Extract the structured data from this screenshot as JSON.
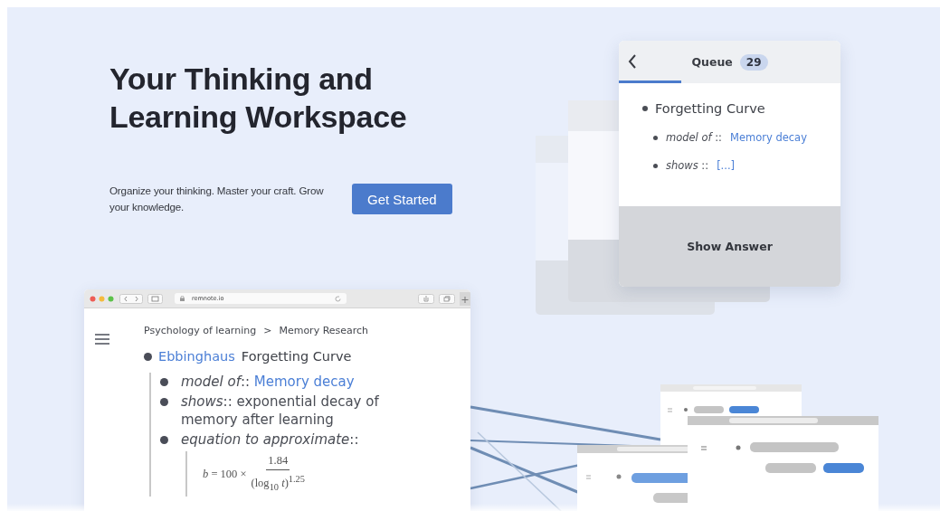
{
  "hero": {
    "title": "Your Thinking and Learning Workspace",
    "subtitle": "Organize your thinking. Master your craft. Grow your knowledge.",
    "cta": "Get Started"
  },
  "flashcard": {
    "title": "Queue",
    "count": "29",
    "level": 0.28,
    "heading": "Forgetting Curve",
    "fields": [
      {
        "text": "*model of* ::",
        "link": "Memory decay"
      },
      {
        "text": "*shows* ::",
        "link": "[...]"
      }
    ],
    "button": "Show Answer"
  },
  "browser": {
    "url": "remnote.io",
    "breadcrumb": [
      "Psychology of learning",
      ">",
      "Memory Research"
    ],
    "title_link": "Ebbinghaus",
    "title_rest": "Forgetting Curve",
    "items": [
      {
        "text": "*model of*::",
        "link": "Memory decay"
      },
      {
        "text": "*shows*:: exponential decay of memory after learning"
      },
      {
        "text": "*equation to approximate*::",
        "formula": {
          "lhs": "*b* = 100 ×",
          "numerator": "1.84",
          "denominator": "(log$_{10}$ *t*)$^{1.25}$"
        }
      }
    ]
  }
}
